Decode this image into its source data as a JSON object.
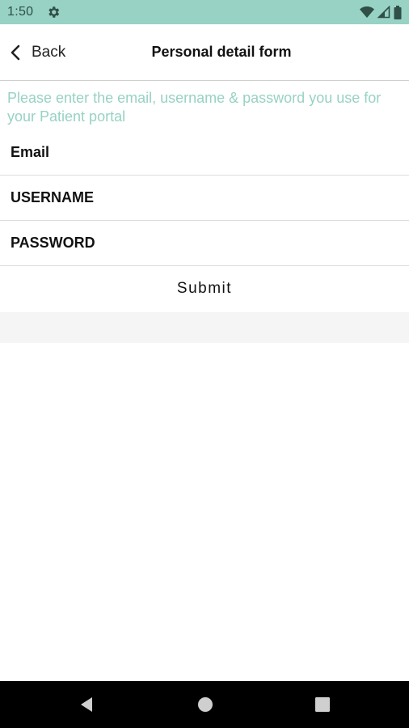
{
  "status_bar": {
    "time": "1:50",
    "background": "#97d2c4",
    "icons": [
      "settings-gear-icon",
      "wifi-icon",
      "cellular-signal-icon",
      "battery-icon"
    ]
  },
  "app_bar": {
    "back_label": "Back",
    "title": "Personal detail form"
  },
  "instruction": "Please enter the email, username & password you use for your Patient portal",
  "form": {
    "email_placeholder": "Email",
    "username_placeholder": "USERNAME",
    "password_placeholder": "PASSWORD",
    "submit_label": "Submit"
  },
  "nav_bar": {
    "icons": [
      "nav-back-icon",
      "nav-home-icon",
      "nav-recents-icon"
    ]
  },
  "colors": {
    "accent": "#97d2c4",
    "divider": "#dcdcdc"
  }
}
